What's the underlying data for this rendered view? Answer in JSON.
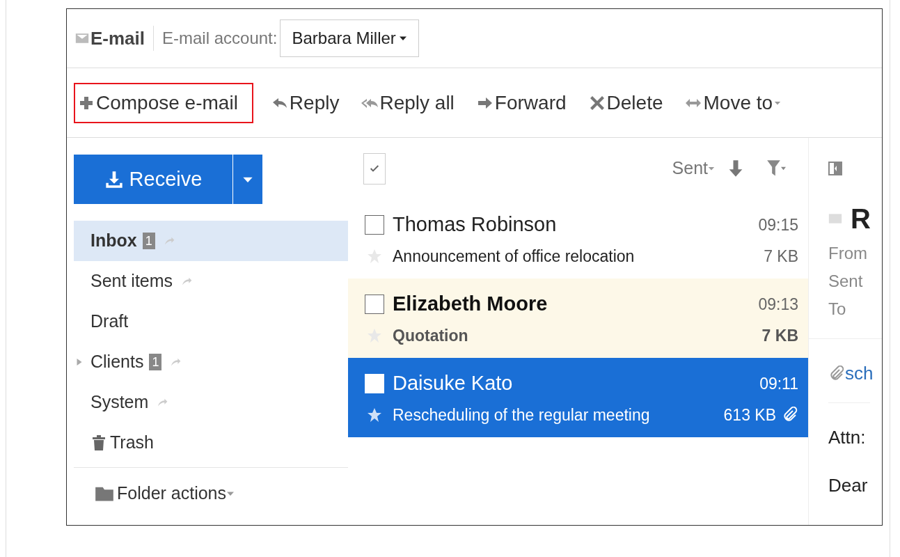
{
  "header": {
    "app_title": "E-mail",
    "account_label": "E-mail account:",
    "account": "Barbara Miller"
  },
  "toolbar": [
    {
      "kind": "compose",
      "label": "Compose e-mail",
      "highlighted": true
    },
    {
      "kind": "reply",
      "label": "Reply",
      "highlighted": false
    },
    {
      "kind": "reply_all",
      "label": "Reply all",
      "highlighted": false
    },
    {
      "kind": "forward",
      "label": "Forward",
      "highlighted": false
    },
    {
      "kind": "delete",
      "label": "Delete",
      "highlighted": false
    },
    {
      "kind": "move",
      "label": "Move to",
      "highlighted": false
    }
  ],
  "receive_button": "Receive",
  "folders": [
    {
      "name": "Inbox",
      "count": "1",
      "selected": true,
      "shared": true,
      "expandable": false,
      "kind": "folder"
    },
    {
      "name": "Sent items",
      "selected": false,
      "shared": true,
      "expandable": false,
      "kind": "folder"
    },
    {
      "name": "Draft",
      "selected": false,
      "shared": false,
      "expandable": false,
      "kind": "folder"
    },
    {
      "name": "Clients",
      "count": "1",
      "selected": false,
      "shared": true,
      "expandable": true,
      "kind": "folder"
    },
    {
      "name": "System",
      "selected": false,
      "shared": true,
      "expandable": false,
      "kind": "folder"
    },
    {
      "name": "Trash",
      "selected": false,
      "shared": false,
      "expandable": false,
      "kind": "trash"
    }
  ],
  "folder_actions": "Folder actions",
  "list_toolbar": {
    "select_all_checked": false,
    "sort": "Sent"
  },
  "messages": [
    {
      "sender": "Thomas Robinson",
      "subject": "Announcement of office relocation",
      "time": "09:15",
      "size": "7 KB",
      "unread": false,
      "selected": false,
      "starred": false,
      "attachment": false
    },
    {
      "sender": "Elizabeth Moore",
      "subject": "Quotation",
      "time": "09:13",
      "size": "7 KB",
      "unread": true,
      "selected": false,
      "starred": false,
      "attachment": false
    },
    {
      "sender": "Daisuke Kato",
      "subject": "Rescheduling of the regular meeting",
      "time": "09:11",
      "size": "613 KB",
      "unread": false,
      "selected": true,
      "starred": false,
      "attachment": true
    }
  ],
  "preview": {
    "title": "R",
    "fields": [
      "From",
      "Sent",
      "To"
    ],
    "attachment": "sch",
    "body": [
      "Attn:",
      "Dear"
    ]
  }
}
